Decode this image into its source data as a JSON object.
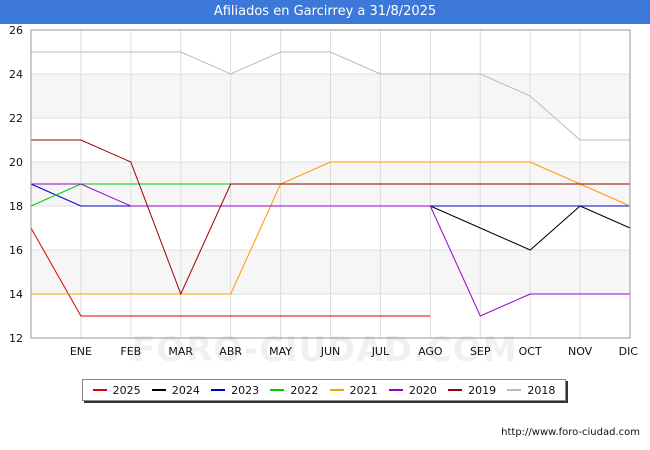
{
  "title": "Afiliados en Garcirrey a 31/8/2025",
  "source": "http://www.foro-ciudad.com",
  "watermark": "FORO-CIUDAD.COM",
  "chart_data": {
    "type": "line",
    "categories": [
      "",
      "ENE",
      "FEB",
      "MAR",
      "ABR",
      "MAY",
      "JUN",
      "JUL",
      "AGO",
      "SEP",
      "OCT",
      "NOV",
      "DIC"
    ],
    "ylim": [
      12,
      26
    ],
    "yticks": [
      12,
      14,
      16,
      18,
      20,
      22,
      24,
      26
    ],
    "grid": true,
    "legend_position": "bottom",
    "series": [
      {
        "name": "2025",
        "color": "#dd0000",
        "values": [
          17,
          13,
          13,
          13,
          13,
          13,
          13,
          13,
          13,
          null,
          null,
          null,
          null
        ]
      },
      {
        "name": "2024",
        "color": "#000000",
        "values": [
          null,
          null,
          null,
          null,
          null,
          null,
          null,
          null,
          18,
          17,
          16,
          18,
          17
        ]
      },
      {
        "name": "2023",
        "color": "#0000cc",
        "values": [
          19,
          18,
          18,
          18,
          18,
          18,
          18,
          18,
          18,
          18,
          18,
          18,
          18
        ]
      },
      {
        "name": "2022",
        "color": "#00cc00",
        "values": [
          18,
          19,
          19,
          19,
          19,
          null,
          null,
          null,
          null,
          null,
          null,
          null,
          null
        ]
      },
      {
        "name": "2021",
        "color": "#ff9900",
        "values": [
          14,
          14,
          14,
          14,
          14,
          19,
          20,
          20,
          20,
          20,
          20,
          19,
          18
        ]
      },
      {
        "name": "2020",
        "color": "#9900cc",
        "values": [
          19,
          19,
          18,
          18,
          18,
          18,
          18,
          18,
          18,
          13,
          14,
          14,
          14
        ]
      },
      {
        "name": "2019",
        "color": "#990000",
        "values": [
          21,
          21,
          20,
          14,
          19,
          19,
          19,
          19,
          19,
          19,
          19,
          19,
          19
        ]
      },
      {
        "name": "2018",
        "color": "#bbbbbb",
        "values": [
          25,
          25,
          25,
          25,
          24,
          25,
          25,
          24,
          24,
          24,
          23,
          21,
          21
        ]
      }
    ]
  }
}
